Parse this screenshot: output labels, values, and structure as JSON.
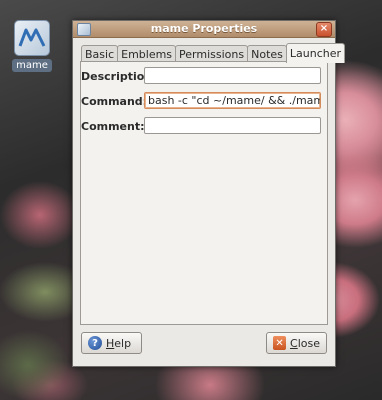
{
  "desktop": {
    "icon_label": "mame",
    "icon_name": "mame-launcher-icon"
  },
  "window": {
    "title": "mame Properties",
    "close_glyph": "×"
  },
  "tabs": [
    {
      "label": "Basic"
    },
    {
      "label": "Emblems"
    },
    {
      "label": "Permissions"
    },
    {
      "label": "Notes"
    },
    {
      "label": "Launcher",
      "active": true
    }
  ],
  "form": {
    "description": {
      "label": "Description:",
      "value": ""
    },
    "command": {
      "label": "Command:",
      "value": "bash -c \"cd ~/mame/ && ./mame\""
    },
    "comment": {
      "label": "Comment:",
      "value": ""
    }
  },
  "buttons": {
    "help": {
      "mnemonic": "H",
      "rest": "elp",
      "icon_glyph": "?"
    },
    "close": {
      "mnemonic": "C",
      "rest": "lose",
      "icon_glyph": "✕"
    }
  },
  "colors": {
    "titlebar": "#b08c6a",
    "focus_border": "#d58c5c",
    "help_icon": "#234f97",
    "close_icon": "#c8531f"
  }
}
